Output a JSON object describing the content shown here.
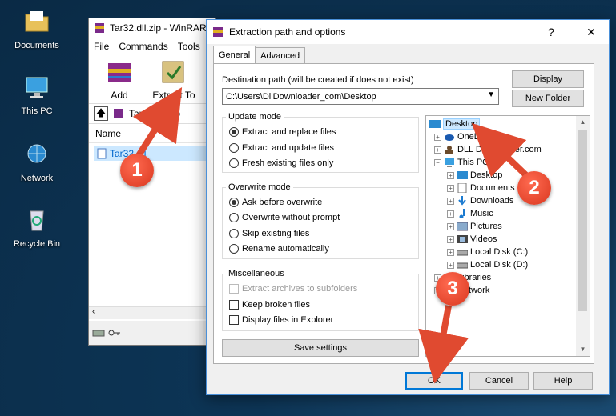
{
  "desktop": {
    "icons": [
      "Documents",
      "This PC",
      "Network",
      "Recycle Bin"
    ]
  },
  "winrar": {
    "title": "Tar32.dll.zip - WinRAR",
    "menu": [
      "File",
      "Commands",
      "Tools"
    ],
    "toolbar": [
      "Add",
      "Extract To"
    ],
    "path": "Tar32.dll.zip",
    "column_name": "Name",
    "selected_file": "Tar32.dll"
  },
  "dialog": {
    "title": "Extraction path and options",
    "help_glyph": "?",
    "close_glyph": "✕",
    "tabs": [
      "General",
      "Advanced"
    ],
    "destination_label": "Destination path (will be created if does not exist)",
    "destination_value": "C:\\Users\\DllDownloader_com\\Desktop",
    "display_button": "Display",
    "new_folder_button": "New Folder",
    "update_mode": {
      "title": "Update mode",
      "options": [
        "Extract and replace files",
        "Extract and update files",
        "Fresh existing files only"
      ],
      "selected": 0
    },
    "overwrite_mode": {
      "title": "Overwrite mode",
      "options": [
        "Ask before overwrite",
        "Overwrite without prompt",
        "Skip existing files",
        "Rename automatically"
      ],
      "selected": 0
    },
    "misc": {
      "title": "Miscellaneous",
      "options": [
        "Extract archives to subfolders",
        "Keep broken files",
        "Display files in Explorer"
      ]
    },
    "save_settings": "Save settings",
    "tree": [
      "Desktop",
      "OneDrive",
      "DLL Downloader.com",
      "This PC",
      "Desktop",
      "Documents",
      "Downloads",
      "Music",
      "Pictures",
      "Videos",
      "Local Disk (C:)",
      "Local Disk (D:)",
      "Libraries",
      "Network"
    ],
    "ok_button": "OK",
    "cancel_button": "Cancel",
    "help_button": "Help"
  },
  "markers": [
    "1",
    "2",
    "3"
  ],
  "colors": {
    "marker": "#d9371f",
    "selection": "#cce8ff",
    "accent": "#0078d7"
  }
}
